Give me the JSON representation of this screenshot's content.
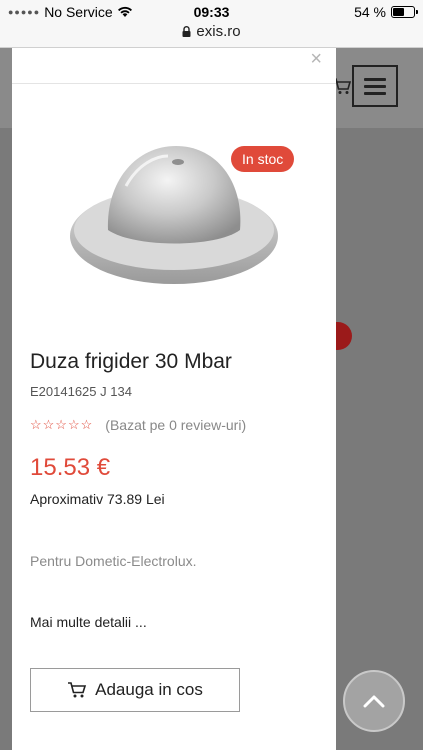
{
  "status_bar": {
    "carrier": "No Service",
    "time": "09:33",
    "battery": "54 %",
    "battery_level": 0.54,
    "url": "exis.ro"
  },
  "modal": {
    "close_glyph": "×",
    "stock_badge": "In stoc",
    "title": "Duza frigider 30 Mbar",
    "sku": "E20141625 J 134",
    "stars": "☆☆☆☆☆",
    "rating": 0,
    "reviews": "(Bazat pe 0 review-uri)",
    "price": "15.53 €",
    "approx_price": "Aproximativ 73.89 Lei",
    "description": "Pentru Dometic-Electrolux.",
    "more_details": "Mai multe detalii ...",
    "add_to_cart": "Adauga in cos"
  },
  "colors": {
    "accent": "#e04a3a",
    "overlay": "#7a7a7a"
  },
  "icons": [
    "wifi-icon",
    "battery-icon",
    "lock-icon",
    "cart-icon",
    "menu-icon",
    "close-icon",
    "chevron-up-icon"
  ]
}
